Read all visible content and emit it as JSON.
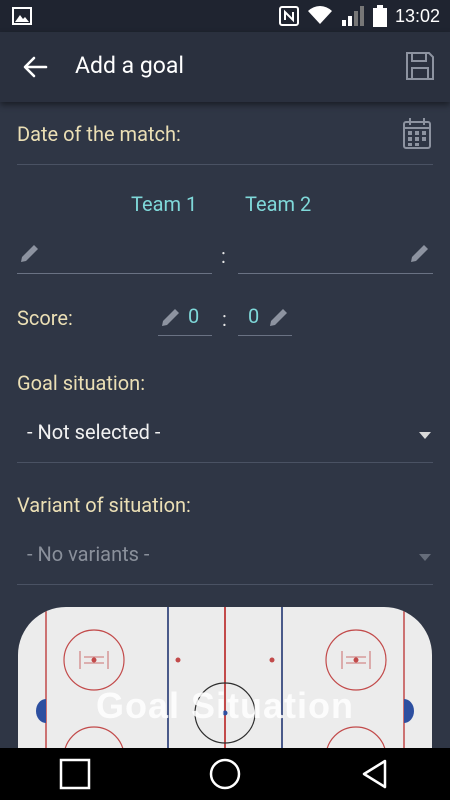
{
  "status": {
    "time": "13:02"
  },
  "appbar": {
    "title": "Add a goal"
  },
  "form": {
    "date_label": "Date of the match:",
    "team1_label": "Team 1",
    "team2_label": "Team 2",
    "team1_value": "",
    "team2_value": "",
    "team_separator": ":",
    "score_label": "Score:",
    "score1": "0",
    "score2": "0",
    "score_separator": ":",
    "goal_situation_label": "Goal situation:",
    "goal_situation_value": "- Not selected -",
    "variant_label": "Variant of situation:",
    "variant_value": "- No variants -"
  },
  "rink": {
    "overlay_text": "Goal Situation"
  },
  "colors": {
    "background": "#2f3645",
    "label": "#ebdfb5",
    "team_accent": "#7fd8d9",
    "disabled_text": "#8a909b"
  }
}
